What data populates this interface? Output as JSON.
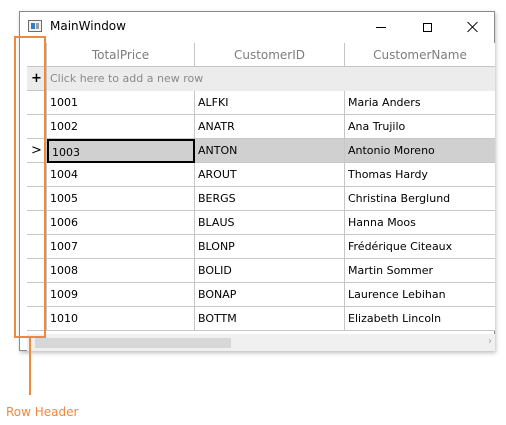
{
  "window": {
    "title": "MainWindow"
  },
  "grid": {
    "columns": [
      "TotalPrice",
      "CustomerID",
      "CustomerName"
    ],
    "add_row_text": "Click here to add a new row",
    "add_row_icon": "plus-icon",
    "current_row_icon": "chevron-right-icon",
    "rows": [
      {
        "total": "1001",
        "id": "ALFKI",
        "name": "Maria Anders"
      },
      {
        "total": "1002",
        "id": "ANATR",
        "name": "Ana Trujilo"
      },
      {
        "total": "1003",
        "id": "ANTON",
        "name": "Antonio Moreno"
      },
      {
        "total": "1004",
        "id": "AROUT",
        "name": "Thomas Hardy"
      },
      {
        "total": "1005",
        "id": "BERGS",
        "name": "Christina Berglund"
      },
      {
        "total": "1006",
        "id": "BLAUS",
        "name": "Hanna Moos"
      },
      {
        "total": "1007",
        "id": "BLONP",
        "name": "Frédérique Citeaux"
      },
      {
        "total": "1008",
        "id": "BOLID",
        "name": "Martin Sommer"
      },
      {
        "total": "1009",
        "id": "BONAP",
        "name": "Laurence Lebihan"
      },
      {
        "total": "1010",
        "id": "BOTTM",
        "name": "Elizabeth Lincoln"
      }
    ],
    "selected_row_index": 2
  },
  "annotation": {
    "label": "Row Header",
    "color": "#f0883e"
  },
  "colors": {
    "selected_row": "#d0d0d0",
    "add_row": "#ececec",
    "grid_line": "#c6c6c6"
  }
}
